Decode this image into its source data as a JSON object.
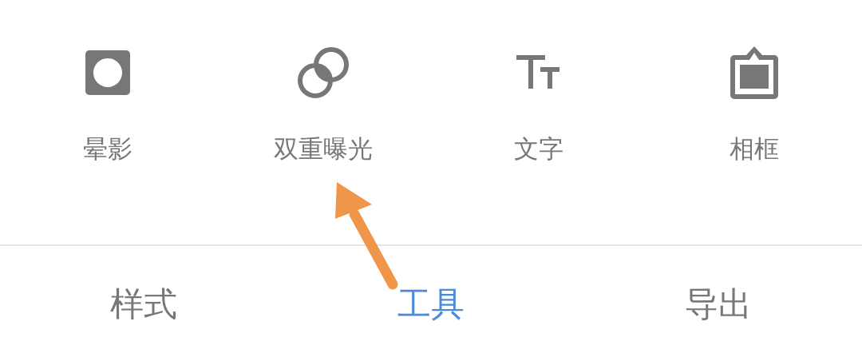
{
  "tools": [
    {
      "kind": "vignette",
      "label": "晕影"
    },
    {
      "kind": "double_exposure",
      "label": "双重曝光"
    },
    {
      "kind": "text",
      "label": "文字"
    },
    {
      "kind": "frame",
      "label": "相框"
    }
  ],
  "tabs": [
    {
      "label": "样式",
      "selected": false
    },
    {
      "label": "工具",
      "selected": true
    },
    {
      "label": "导出",
      "selected": false
    }
  ]
}
